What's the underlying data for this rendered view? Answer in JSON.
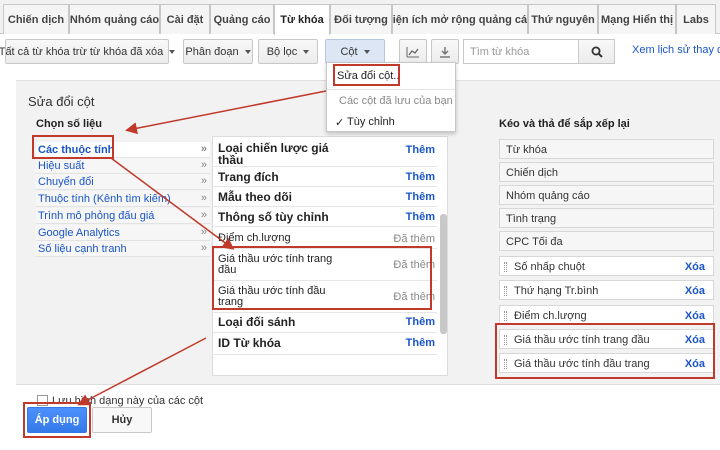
{
  "tabs": [
    {
      "label": "Chiến dịch"
    },
    {
      "label": "Nhóm quảng cáo"
    },
    {
      "label": "Cài đặt"
    },
    {
      "label": "Quảng cáo"
    },
    {
      "label": "Từ khóa"
    },
    {
      "label": "Đối tượng"
    },
    {
      "label": "Tiện ích mở rộng quảng cáo"
    },
    {
      "label": "Thứ nguyên"
    },
    {
      "label": "Mạng Hiển thị"
    },
    {
      "label": "Labs"
    }
  ],
  "toolbar": {
    "filter_all": "Tất cả từ khóa trừ từ khóa đã xóa",
    "segment": "Phân đoạn",
    "filter": "Bộ lọc",
    "columns": "Cột",
    "search_placeholder": "Tìm từ khóa",
    "history_link": "Xem lịch sử thay đổ"
  },
  "dropdown": {
    "modify": "Sửa đổi cột..",
    "saved_header": "Các cột đã lưu của bạn",
    "custom": "Tùy chỉnh",
    "check": "✓"
  },
  "panel": {
    "title": "Sửa đổi cột",
    "choose_metrics": "Chọn số liệu",
    "drag_title": "Kéo và thả để sắp xếp lại",
    "metrics": [
      "Các thuộc tính",
      "Hiệu suất",
      "Chuyển đổi",
      "Thuộc tính (Kênh tìm kiếm)",
      "Trình mô phỏng đấu giá",
      "Google Analytics",
      "Số liệu cạnh tranh"
    ],
    "chevron": "»",
    "columns": [
      {
        "name": "Loại chiến lược giá thầu",
        "action": "Thêm"
      },
      {
        "name": "Trang đích",
        "action": "Thêm"
      },
      {
        "name": "Mẫu theo dõi",
        "action": "Thêm"
      },
      {
        "name": "Thông số tùy chỉnh",
        "action": "Thêm"
      },
      {
        "name": "Điểm ch.lượng",
        "action": "Đã thêm"
      },
      {
        "name": "Giá thầu ước tính trang đầu",
        "action": "Đã thêm"
      },
      {
        "name": "Giá thầu ước tính đầu trang",
        "action": "Đã thêm"
      },
      {
        "name": "Loại đối sánh",
        "action": "Thêm"
      },
      {
        "name": "ID Từ khóa",
        "action": "Thêm"
      }
    ],
    "selected_fixed": [
      "Từ khóa",
      "Chiến dịch",
      "Nhóm quảng cáo",
      "Tình trạng",
      "CPC Tối đa"
    ],
    "selected_removable": [
      {
        "name": "Số nhấp chuột",
        "action": "Xóa"
      },
      {
        "name": "Thứ hạng Tr.bình",
        "action": "Xóa"
      },
      {
        "name": "Điểm ch.lượng",
        "action": "Xóa"
      },
      {
        "name": "Giá thầu ước tính trang đầu",
        "action": "Xóa"
      },
      {
        "name": "Giá thầu ước tính đầu trang",
        "action": "Xóa"
      }
    ],
    "save_combo": "Lưu hình dạng này của các cột",
    "apply": "Áp dụng",
    "cancel": "Hủy"
  },
  "colors": {
    "accent": "#1a55c7",
    "highlight": "#c0392b",
    "apply": "#4d90fe"
  },
  "icons": [
    "chart-icon",
    "download-icon",
    "search-icon",
    "caret-down-icon",
    "drag-handle-icon"
  ]
}
